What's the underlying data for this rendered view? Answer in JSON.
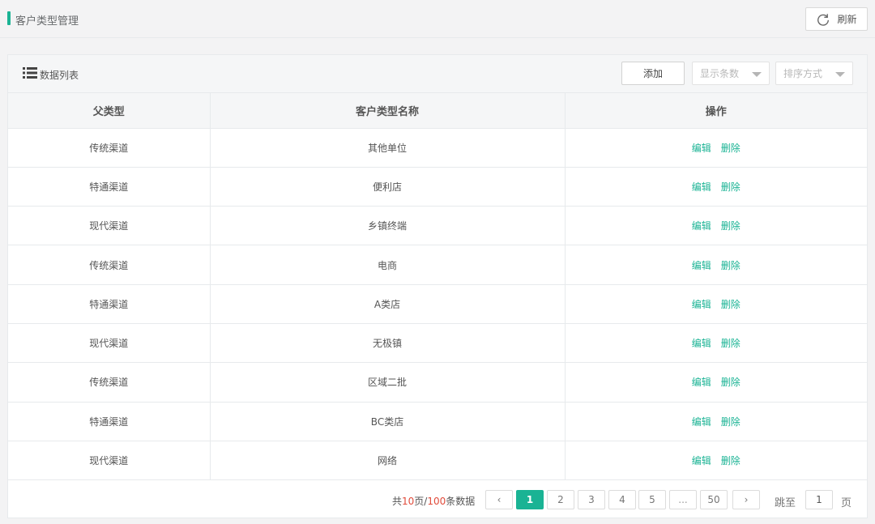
{
  "header": {
    "title": "客户类型管理",
    "refresh_label": "刷新"
  },
  "panel": {
    "title": "数据列表",
    "add_label": "添加",
    "page_size_placeholder": "显示条数",
    "sort_placeholder": "排序方式"
  },
  "table": {
    "columns": [
      "父类型",
      "客户类型名称",
      "操作"
    ],
    "rows": [
      {
        "parent": "传统渠道",
        "name": "其他单位"
      },
      {
        "parent": "特通渠道",
        "name": "便利店"
      },
      {
        "parent": "现代渠道",
        "name": "乡镇终端"
      },
      {
        "parent": "传统渠道",
        "name": "电商"
      },
      {
        "parent": "特通渠道",
        "name": "A类店"
      },
      {
        "parent": "现代渠道",
        "name": "无极镇"
      },
      {
        "parent": "传统渠道",
        "name": "区域二批"
      },
      {
        "parent": "特通渠道",
        "name": "BC类店"
      },
      {
        "parent": "现代渠道",
        "name": "网络"
      }
    ],
    "edit_label": "编辑",
    "delete_label": "删除"
  },
  "pagination": {
    "total_prefix": "共",
    "total_pages": "10",
    "pages_unit": "页/",
    "total_records": "100",
    "records_unit": "条数据",
    "prev": "‹",
    "next": "›",
    "pages": [
      "1",
      "2",
      "3",
      "4",
      "5",
      "...",
      "50"
    ],
    "current": "1",
    "jump_label": "跳至",
    "jump_value": "1",
    "jump_suffix": "页"
  },
  "colors": {
    "accent": "#1ab394",
    "highlight": "#e14b3b"
  }
}
